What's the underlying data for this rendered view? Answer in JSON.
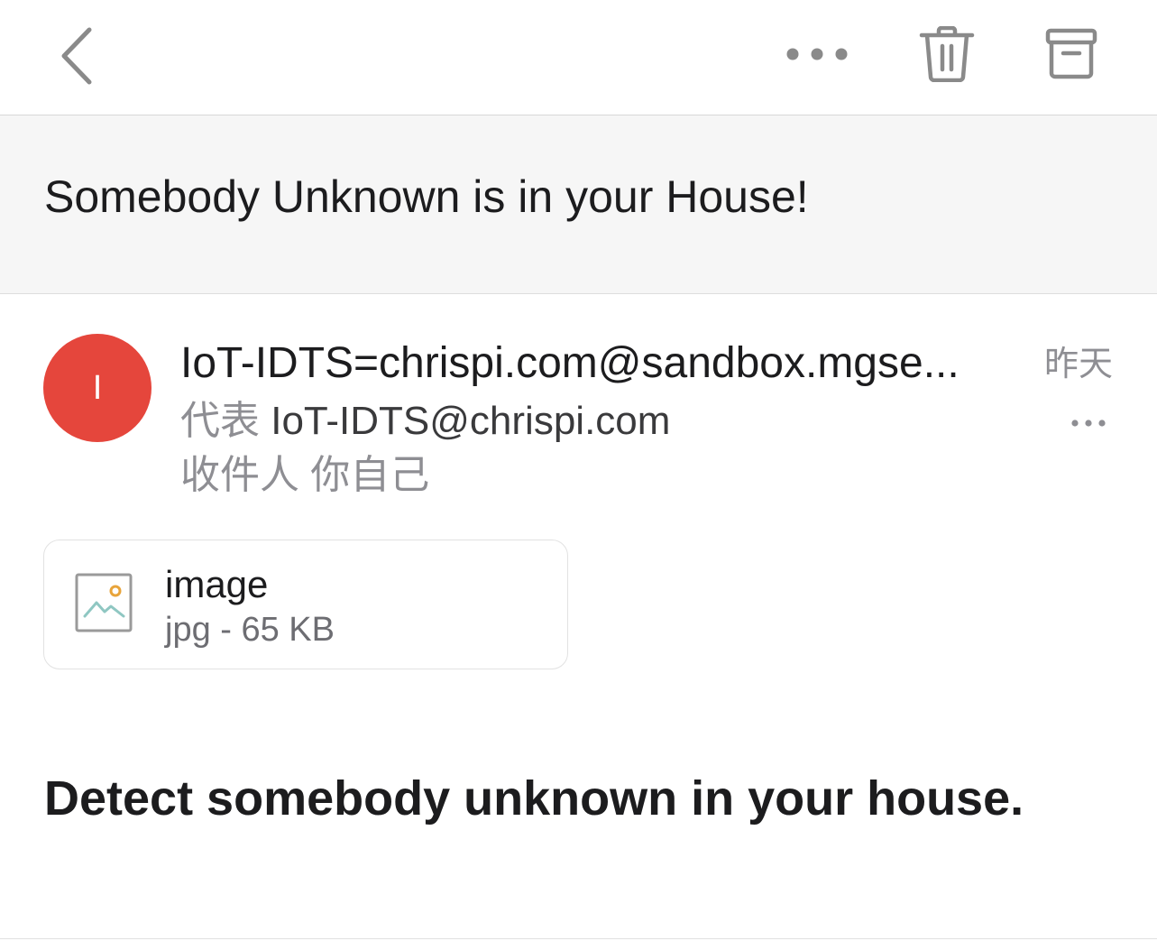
{
  "toolbar": {
    "back": "chevron-left-icon",
    "more": "more-horizontal-icon",
    "delete": "trash-icon",
    "archive": "archive-box-icon"
  },
  "email": {
    "subject": "Somebody Unknown is in your House!",
    "avatar_letter": "I",
    "avatar_color": "#e5463c",
    "sender": "IoT-IDTS=chrispi.com@sandbox.mgse...",
    "time": "昨天",
    "on_behalf_prefix": "代表",
    "on_behalf_address": "IoT-IDTS@chrispi.com",
    "recipient": "收件人 你自己",
    "attachment": {
      "name": "image",
      "meta": "jpg - 65 KB",
      "icon": "image-file-icon"
    },
    "body": "Detect somebody unknown in your house."
  }
}
